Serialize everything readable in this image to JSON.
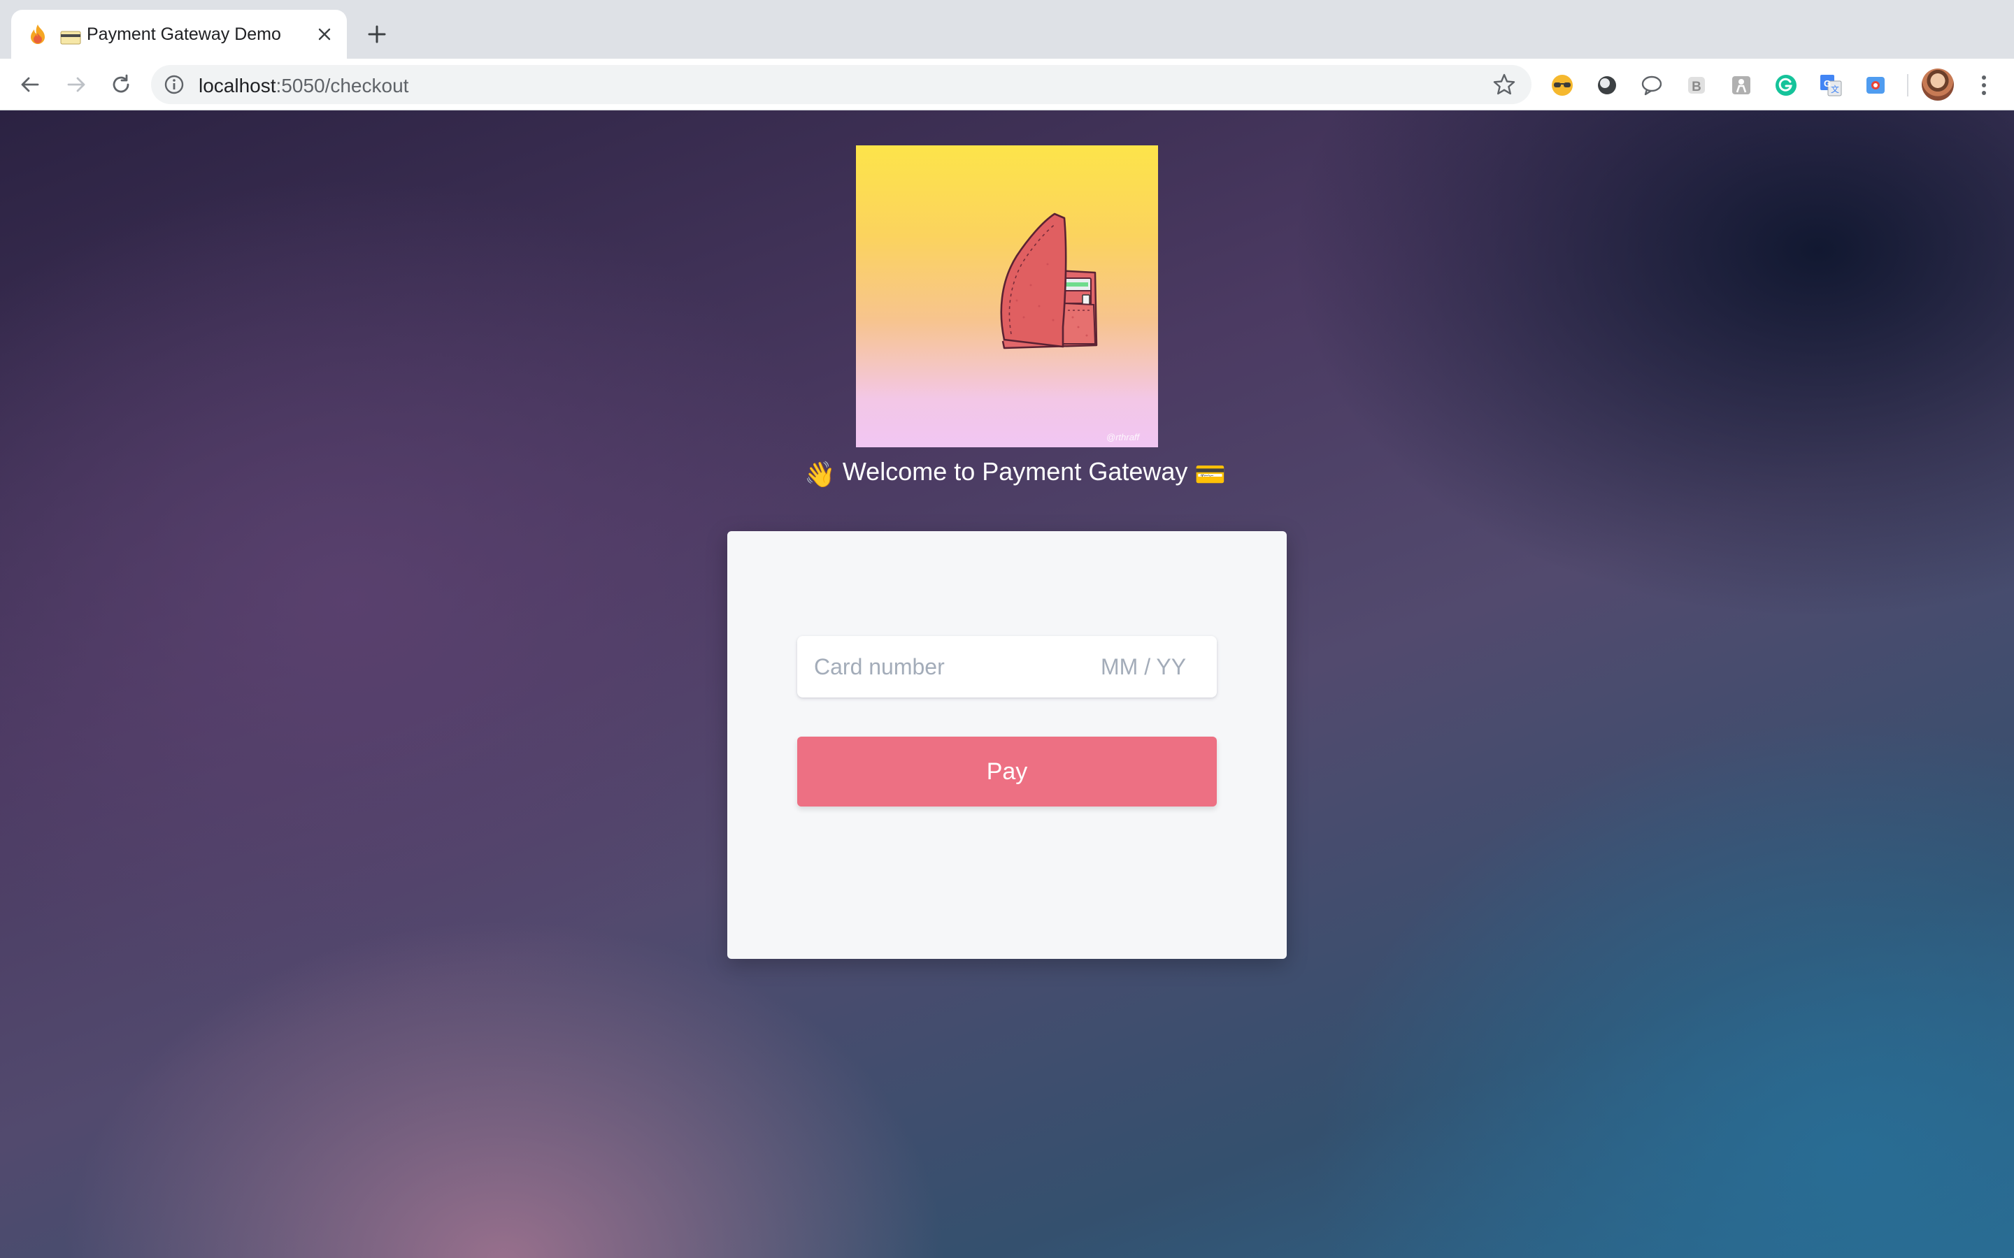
{
  "browser": {
    "tab": {
      "favicon": "fire-icon",
      "title_icon": "credit-card-icon",
      "title": "Payment Gateway Demo"
    },
    "address": {
      "host": "localhost",
      "path": ":5050/checkout"
    },
    "extensions": [
      "sunglasses-extension-icon",
      "dark-circle-extension-icon",
      "chat-bubble-extension-icon",
      "b-extension-icon",
      "person-extension-icon",
      "grammarly-extension-icon",
      "google-translate-extension-icon",
      "screen-recorder-extension-icon"
    ]
  },
  "page": {
    "hero_watermark": "@rthraff",
    "welcome": {
      "lead_emoji": "👋",
      "text": "Welcome to Payment Gateway",
      "trail_emoji": "💳"
    },
    "form": {
      "card_number_placeholder": "Card number",
      "expiry_placeholder": "MM / YY",
      "pay_label": "Pay"
    },
    "colors": {
      "pay_button": "#ed7083",
      "panel": "#f6f7f9",
      "placeholder": "#a3acb9"
    }
  }
}
